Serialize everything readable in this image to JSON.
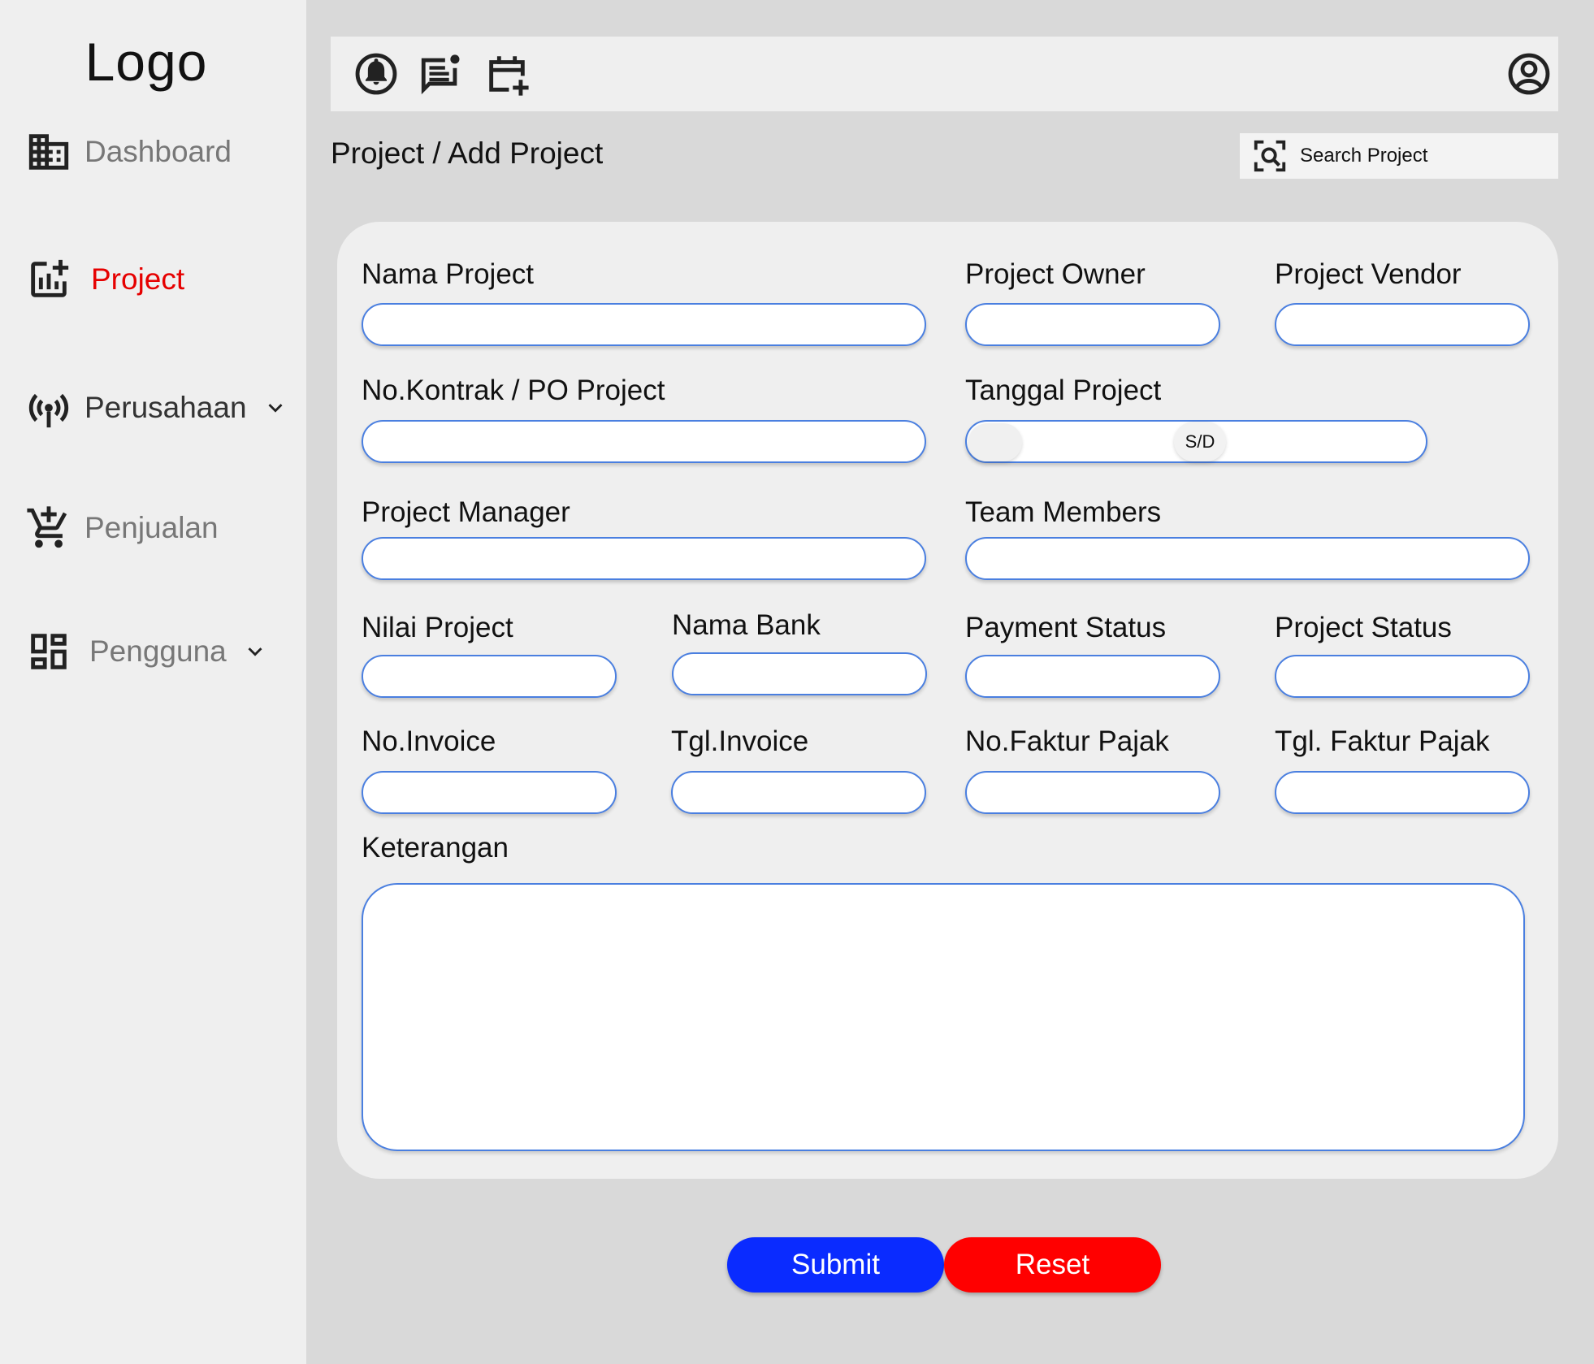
{
  "sidebar": {
    "logo": "Logo",
    "items": [
      {
        "label": "Dashboard",
        "icon": "building-icon"
      },
      {
        "label": "Project",
        "icon": "add-chart-icon",
        "active": true
      },
      {
        "label": "Perusahaan",
        "icon": "broadcast-icon",
        "expandable": true
      },
      {
        "label": "Penjualan",
        "icon": "add-cart-icon"
      },
      {
        "label": "Pengguna",
        "icon": "dashboard-grid-icon",
        "expandable": true
      }
    ]
  },
  "topbar": {
    "icons": [
      "notification-bell-icon",
      "chat-icon",
      "calendar-add-icon",
      "account-circle-icon"
    ]
  },
  "breadcrumb": "Project / Add Project",
  "search": {
    "placeholder": "Search Project",
    "icon": "image-search-icon"
  },
  "form": {
    "nama_project": "Nama Project",
    "project_owner": "Project Owner",
    "project_vendor": "Project Vendor",
    "no_kontrak": "No.Kontrak / PO Project",
    "tanggal_project": "Tanggal Project",
    "tanggal_separator": "S/D",
    "project_manager": "Project Manager",
    "team_members": "Team Members",
    "nilai_project": "Nilai Project",
    "nama_bank": "Nama Bank",
    "payment_status": "Payment Status",
    "project_status": "Project Status",
    "no_invoice": "No.Invoice",
    "tgl_invoice": "Tgl.Invoice",
    "no_faktur_pajak": "No.Faktur Pajak",
    "tgl_faktur_pajak": "Tgl. Faktur Pajak",
    "keterangan": "Keterangan"
  },
  "buttons": {
    "submit": "Submit",
    "reset": "Reset"
  },
  "colors": {
    "active_nav": "#e60000",
    "submit": "#0a2bff",
    "reset": "#ff0000",
    "input_border": "#4a7fe0"
  }
}
